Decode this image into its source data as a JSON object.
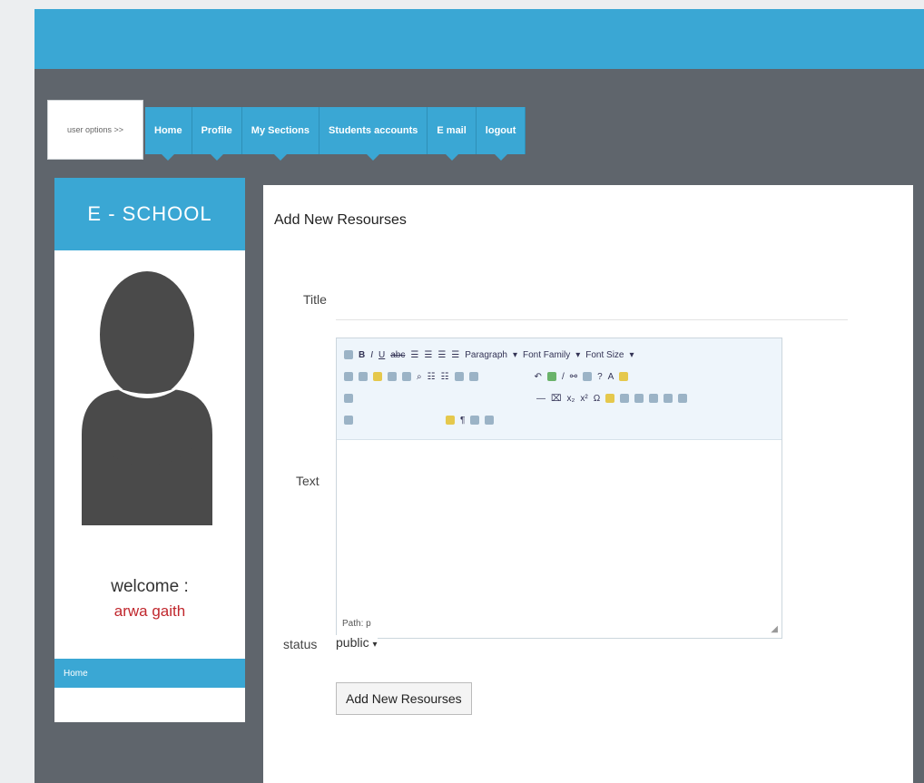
{
  "header": {
    "user_options": "user options >>",
    "nav": [
      "Home",
      "Profile",
      "My Sections",
      "Students accounts",
      "E mail",
      "logout"
    ]
  },
  "sidebar": {
    "logo": "E - SCHOOL",
    "welcome": "welcome :",
    "username": "arwa gaith",
    "menu_home": "Home"
  },
  "main": {
    "title": "Add New Resourses",
    "title_label": "Title",
    "text_label": "Text",
    "status_label": "status",
    "status_value": "public",
    "submit_label": "Add New Resourses"
  },
  "editor": {
    "paragraph": "Paragraph",
    "font_family": "Font Family",
    "font_size": "Font Size",
    "path": "Path: p"
  },
  "colors": {
    "accent": "#3aa7d4",
    "dark_bg": "#5f656c",
    "username": "#c0272d"
  }
}
